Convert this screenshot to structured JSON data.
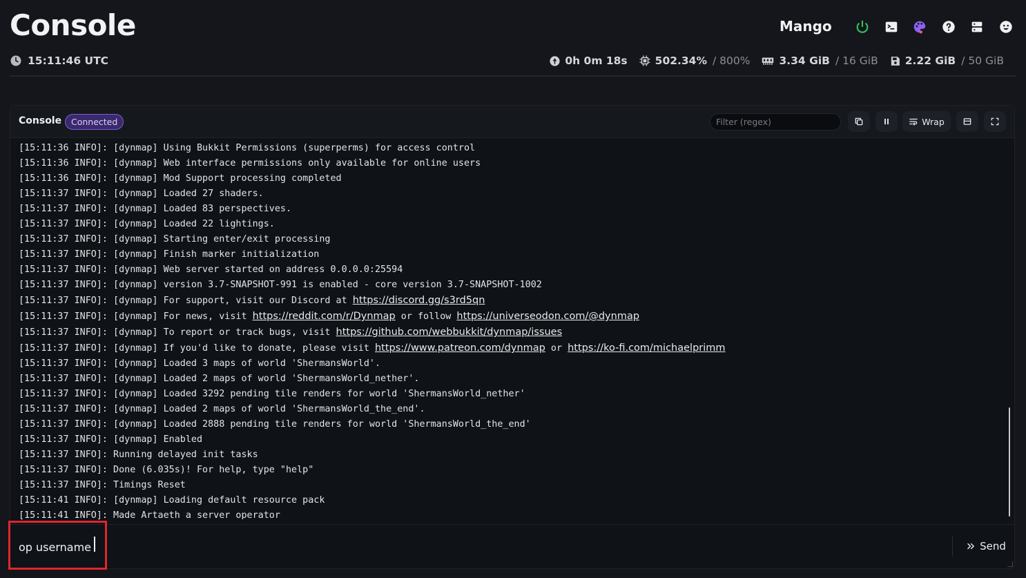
{
  "header": {
    "title": "Console",
    "server_name": "Mango",
    "icons": [
      "power-icon",
      "terminal-icon",
      "palette-icon",
      "help-icon",
      "server-list-icon",
      "smiley-icon"
    ],
    "time": "15:11:46 UTC"
  },
  "stats": {
    "uptime": "0h 0m 18s",
    "cpu": "502.34%",
    "cpu_max": "/ 800%",
    "memory": "3.34 GiB",
    "memory_max": "/ 16 GiB",
    "disk": "2.22 GiB",
    "disk_max": "/ 50 GiB"
  },
  "console": {
    "title": "Console",
    "status_badge": "Connected",
    "filter_placeholder": "Filter (regex)",
    "wrap_label": "Wrap",
    "input_value": "op username",
    "send_label": "Send"
  },
  "log_lines": [
    {
      "text": "[15:11:36 INFO]: [dynmap] Using Bukkit Permissions (superperms) for access control"
    },
    {
      "text": "[15:11:36 INFO]: [dynmap] Web interface permissions only available for online users"
    },
    {
      "text": "[15:11:36 INFO]: [dynmap] Mod Support processing completed"
    },
    {
      "text": "[15:11:37 INFO]: [dynmap] Loaded 27 shaders."
    },
    {
      "text": "[15:11:37 INFO]: [dynmap] Loaded 83 perspectives."
    },
    {
      "text": "[15:11:37 INFO]: [dynmap] Loaded 22 lightings."
    },
    {
      "text": "[15:11:37 INFO]: [dynmap] Starting enter/exit processing"
    },
    {
      "text": "[15:11:37 INFO]: [dynmap] Finish marker initialization"
    },
    {
      "text": "[15:11:37 INFO]: [dynmap] Web server started on address 0.0.0.0:25594"
    },
    {
      "text": "[15:11:37 INFO]: [dynmap] version 3.7-SNAPSHOT-991 is enabled - core version 3.7-SNAPSHOT-1002"
    },
    {
      "text": "[15:11:37 INFO]: [dynmap] For support, visit our Discord at ",
      "links": [
        {
          "text": "https://discord.gg/s3rd5qn",
          "after": ""
        }
      ]
    },
    {
      "text": "[15:11:37 INFO]: [dynmap] For news, visit ",
      "links": [
        {
          "text": "https://reddit.com/r/Dynmap",
          "after": " or follow "
        },
        {
          "text": "https://universeodon.com/@dynmap",
          "after": ""
        }
      ]
    },
    {
      "text": "[15:11:37 INFO]: [dynmap] To report or track bugs, visit ",
      "links": [
        {
          "text": "https://github.com/webbukkit/dynmap/issues",
          "after": ""
        }
      ]
    },
    {
      "text": "[15:11:37 INFO]: [dynmap] If you'd like to donate, please visit ",
      "links": [
        {
          "text": "https://www.patreon.com/dynmap",
          "after": " or "
        },
        {
          "text": "https://ko-fi.com/michaelprimm",
          "after": ""
        }
      ]
    },
    {
      "text": "[15:11:37 INFO]: [dynmap] Loaded 3 maps of world 'ShermansWorld'."
    },
    {
      "text": "[15:11:37 INFO]: [dynmap] Loaded 2 maps of world 'ShermansWorld_nether'."
    },
    {
      "text": "[15:11:37 INFO]: [dynmap] Loaded 3292 pending tile renders for world 'ShermansWorld_nether'"
    },
    {
      "text": "[15:11:37 INFO]: [dynmap] Loaded 2 maps of world 'ShermansWorld_the_end'."
    },
    {
      "text": "[15:11:37 INFO]: [dynmap] Loaded 2888 pending tile renders for world 'ShermansWorld_the_end'"
    },
    {
      "text": "[15:11:37 INFO]: [dynmap] Enabled"
    },
    {
      "text": "[15:11:37 INFO]: Running delayed init tasks"
    },
    {
      "text": "[15:11:37 INFO]: Done (6.035s)! For help, type \"help\""
    },
    {
      "text": "[15:11:37 INFO]: Timings Reset"
    },
    {
      "text": "[15:11:41 INFO]: [dynmap] Loading default resource pack"
    },
    {
      "text": "[15:11:41 INFO]: Made Artaeth a server operator"
    }
  ]
}
